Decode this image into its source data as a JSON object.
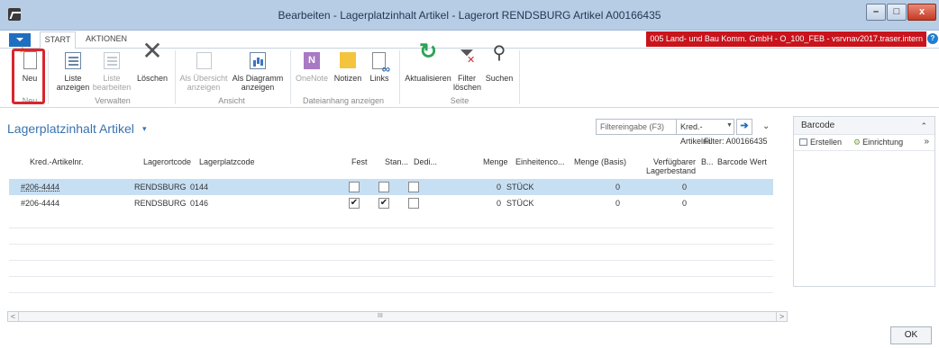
{
  "window": {
    "title": "Bearbeiten - Lagerplatzinhalt Artikel - Lagerort RENDSBURG Artikel A00166435",
    "min_label": "–",
    "max_label": "□",
    "close_label": "x"
  },
  "ribbon_tabs": {
    "start": "START",
    "aktionen": "AKTIONEN",
    "company": "005 Land- und Bau Komm. GmbH - O_100_FEB - vsrvnav2017.traser.intern",
    "help": "?"
  },
  "ribbon": {
    "neu": "Neu",
    "liste_anzeigen": [
      "Liste",
      "anzeigen"
    ],
    "liste_bearbeiten": [
      "Liste",
      "bearbeiten"
    ],
    "loeschen": "Löschen",
    "als_uebersicht": [
      "Als Übersicht",
      "anzeigen"
    ],
    "als_diagramm": [
      "Als Diagramm",
      "anzeigen"
    ],
    "onenote": "OneNote",
    "notizen": "Notizen",
    "links": "Links",
    "aktualisieren": "Aktualisieren",
    "filter_loeschen": [
      "Filter",
      "löschen"
    ],
    "suchen": "Suchen",
    "groups": {
      "neu": "Neu",
      "verwalten": "Verwalten",
      "ansicht": "Ansicht",
      "dateianhang": "Dateianhang anzeigen",
      "seite": "Seite"
    },
    "icons": {
      "onenote_glyph": "N",
      "loeschen_glyph": "✕",
      "refresh_glyph": "↻",
      "filter_glyph": "⏷",
      "search_glyph": "⚲"
    }
  },
  "list": {
    "title": "Lagerplatzinhalt Artikel",
    "title_caret": "▾",
    "filter_placeholder": "Filtereingabe (F3)",
    "filter_field": "Kred.-Artikelnr.",
    "filter_field_arrow": "▼",
    "filter_go": "➔",
    "expand_caret": "⌄",
    "active_filter": "Filter: A00166435",
    "columns": {
      "kred_artikelnr": "Kred.-Artikelnr.",
      "lagerortcode": "Lagerortcode",
      "lagerplatzcode": "Lagerplatzcode",
      "fest": "Fest",
      "stan": "Stan...",
      "dedi": "Dedi...",
      "menge": "Menge",
      "einheitenco": "Einheitenco...",
      "menge_basis": "Menge (Basis)",
      "verfuegbar": [
        "Verfügbarer",
        "Lagerbestand"
      ],
      "b": "B...",
      "barcode_wert": "Barcode Wert"
    },
    "rows": [
      {
        "kred_artikelnr": "#206-4444",
        "lagerortcode": "RENDSBURG",
        "lagerplatzcode": "0144",
        "fest": "",
        "stan": "",
        "dedi": "",
        "menge": "0",
        "einheit": "STÜCK",
        "menge_basis": "0",
        "verfuegbar": "0"
      },
      {
        "kred_artikelnr": "#206-4444",
        "lagerortcode": "RENDSBURG",
        "lagerplatzcode": "0146",
        "fest": "✔",
        "stan": "✔",
        "dedi": "",
        "menge": "0",
        "einheit": "STÜCK",
        "menge_basis": "0",
        "verfuegbar": "0"
      }
    ],
    "scroll": {
      "left": "<",
      "right": ">",
      "grip": "III"
    }
  },
  "factbox": {
    "title": "Barcode",
    "collapse": "⌃",
    "erstellen": "Erstellen",
    "einrichtung": "Einrichtung",
    "more": "»",
    "gear_glyph": "⚙"
  },
  "ok_label": "OK"
}
